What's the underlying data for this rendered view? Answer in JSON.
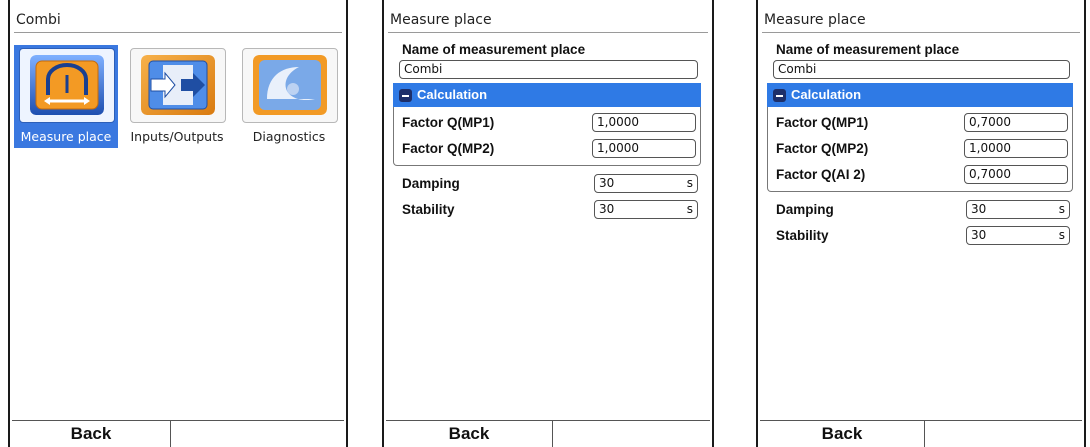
{
  "screen1": {
    "title": "Combi",
    "tiles": [
      {
        "label": "Measure place",
        "icon": "measure-place-icon",
        "selected": true
      },
      {
        "label": "Inputs/Outputs",
        "icon": "inputs-outputs-icon",
        "selected": false
      },
      {
        "label": "Diagnostics",
        "icon": "diagnostics-icon",
        "selected": false
      }
    ],
    "footer": {
      "left": "Back",
      "right": ""
    }
  },
  "screen2": {
    "title": "Measure place",
    "name_label": "Name of measurement place",
    "name_value": "Combi",
    "section": "Calculation",
    "factors": [
      {
        "label": "Factor Q(MP1)",
        "value": "1,0000"
      },
      {
        "label": "Factor Q(MP2)",
        "value": "1,0000"
      }
    ],
    "damping": {
      "label": "Damping",
      "value": "30",
      "unit": "s"
    },
    "stability": {
      "label": "Stability",
      "value": "30",
      "unit": "s"
    },
    "footer": {
      "left": "Back",
      "right": ""
    }
  },
  "screen3": {
    "title": "Measure place",
    "name_label": "Name of measurement place",
    "name_value": "Combi",
    "section": "Calculation",
    "factors": [
      {
        "label": "Factor Q(MP1)",
        "value": "0,7000"
      },
      {
        "label": "Factor Q(MP2)",
        "value": "1,0000"
      },
      {
        "label": "Factor Q(AI 2)",
        "value": "0,7000"
      }
    ],
    "damping": {
      "label": "Damping",
      "value": "30",
      "unit": "s"
    },
    "stability": {
      "label": "Stability",
      "value": "30",
      "unit": "s"
    },
    "footer": {
      "left": "Back",
      "right": ""
    }
  },
  "colors": {
    "accent": "#2f7ae5",
    "selection": "#3a78e0",
    "minus": "#1d2f6a"
  }
}
